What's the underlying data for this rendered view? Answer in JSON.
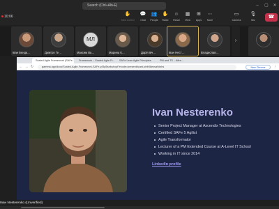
{
  "topbar": {
    "search_placeholder": "Search (Ctrl+Alt+E)",
    "time": "10:06",
    "buttons": [
      {
        "label": "Take control",
        "icon": "hand-icon",
        "dim": true
      },
      {
        "label": "Chat",
        "icon": "chat-icon"
      },
      {
        "label": "People",
        "icon": "people-icon"
      },
      {
        "label": "Raise",
        "icon": "raise-hand-icon"
      },
      {
        "label": "React",
        "icon": "react-icon"
      },
      {
        "label": "View",
        "icon": "view-icon"
      },
      {
        "label": "Apps",
        "icon": "apps-icon"
      },
      {
        "label": "More",
        "icon": "more-icon"
      },
      {
        "label": "Camera",
        "icon": "camera-icon"
      },
      {
        "label": "Mic",
        "icon": "mic-icon"
      },
      {
        "label": "Share",
        "icon": "share-icon"
      }
    ]
  },
  "participants": [
    {
      "name": "Іван Бенда…",
      "color": "#6b4a3a"
    },
    {
      "name": "Дмитро Ге…",
      "color": "#4a4a4a"
    },
    {
      "name": "Максим Ва…",
      "initials": "МЛ",
      "color": "#d0d0d0"
    },
    {
      "name": "Марина К…",
      "color": "#6a5a4a"
    },
    {
      "name": "Дарія Івч…",
      "color": "#5a4a3a"
    },
    {
      "name": "Іван Нест…",
      "color": "#8a6a4a",
      "active": true
    },
    {
      "name": "Владислав…",
      "color": "#4a4a4a"
    },
    {
      "name": "",
      "color": "#3a3a3a"
    }
  ],
  "browser": {
    "tabs": [
      {
        "label": "Scaled Agile Framework (SAFe…",
        "active": true
      },
      {
        "label": "Framework – Scaled Agile Fr…"
      },
      {
        "label": "SAFe Lean Agile Principles"
      },
      {
        "label": "PM and TS – Alfre…"
      }
    ],
    "url": "gamma.app/docs/Scaled-Agile-Framework-SAFe-pf3yl5snbuhcpf?mode=present#card-zbfr08ezsa9dxhs",
    "new_chrome": "New Chrome available"
  },
  "slide": {
    "name": "Ivan Nesterenko",
    "bullets": [
      "Senior Project Manager at Ascendix Technologies",
      "Certified SAFe 5 Agilist",
      "Agile Transformator",
      "Lecturer of a PM Extended Course at A-Level IT School",
      "Working in IT since 2014"
    ],
    "link": "LinkedIn profile"
  },
  "presenter": "Іван Nesterenko (Unverified)"
}
